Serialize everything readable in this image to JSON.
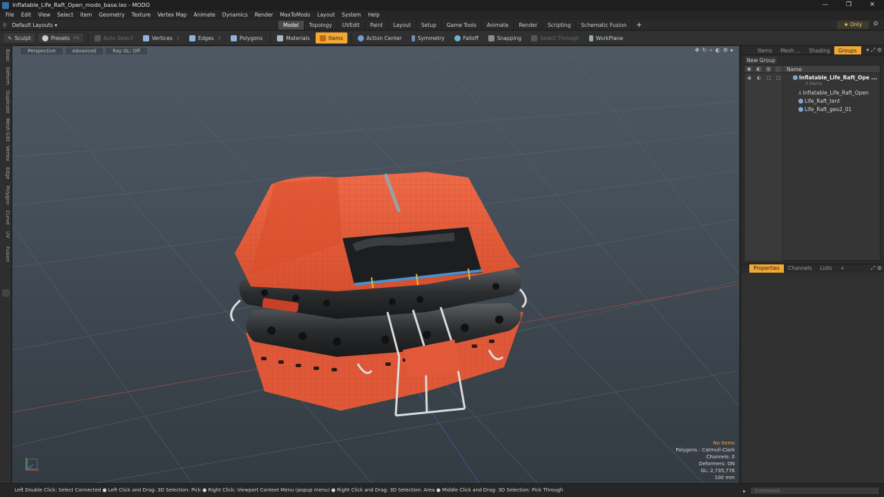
{
  "window": {
    "title": "Inflatable_Life_Raft_Open_modo_base.lxo - MODO",
    "controls": [
      "—",
      "❐",
      "✕"
    ]
  },
  "menu": [
    "File",
    "Edit",
    "View",
    "Select",
    "Item",
    "Geometry",
    "Texture",
    "Vertex Map",
    "Animate",
    "Dynamics",
    "Render",
    "MaxToModo",
    "Layout",
    "System",
    "Help"
  ],
  "layout_dropdown": "Default Layouts ▾",
  "tabs": [
    "Model",
    "Topology",
    "UVEdit",
    "Paint",
    "Layout",
    "Setup",
    "Game Tools",
    "Animate",
    "Render",
    "Scripting",
    "Schematic Fusion"
  ],
  "active_tab": "Model",
  "only_label": "★  Only",
  "toolbar": {
    "sculpt": "Sculpt",
    "presets": "Presets",
    "presets_key": "F6",
    "auto_select": "Auto Select",
    "vertices": "Vertices",
    "vertices_key": "1",
    "edges": "Edges",
    "edges_key": "2",
    "polygons": "Polygons",
    "materials": "Materials",
    "items": "Items",
    "action_center": "Action Center",
    "symmetry": "Symmetry",
    "falloff": "Falloff",
    "snapping": "Snapping",
    "select_through": "Select Through",
    "workplane": "WorkPlane"
  },
  "left_tabs": [
    "Basic",
    "Deform",
    "Duplicate",
    "Mesh Edit",
    "Vertex",
    "Edge",
    "Polygon",
    "Curve",
    "UV",
    "Fusion"
  ],
  "viewport": {
    "view_mode": "Perspective",
    "shading": "Advanced",
    "raygl": "Ray GL: Off",
    "tools": [
      "✥",
      "↻",
      "⌕",
      "◐",
      "⚙",
      "▸"
    ],
    "info": {
      "selection": "No Items",
      "polygons": "Polygons : Catmull-Clark",
      "channels": "Channels: 0",
      "deformers": "Deformers: ON",
      "gl": "GL: 2,735,776",
      "scale": "100 mm"
    }
  },
  "right_panel": {
    "tabs": [
      "Items",
      "Mesh ...",
      "Shading",
      "Groups"
    ],
    "active_tab": "Groups",
    "new_group": "New Group",
    "name_header": "Name",
    "tree": {
      "root": "Inflatable_Life_Raft_Ope ...",
      "root_count": "3 Items",
      "children": [
        "Inflatable_Life_Raft_Open",
        "Life_Raft_tent",
        "Life_Raft_geo2_01"
      ]
    },
    "props_tabs": [
      "Properties",
      "Channels",
      "Lists"
    ],
    "props_active": "Properties"
  },
  "status": {
    "hint": "Left Double Click: Select Connected ● Left Click and Drag: 3D Selection: Pick ● Right Click: Viewport Context Menu (popup menu) ● Right Click and Drag: 3D Selection: Area ● Middle Click and Drag: 3D Selection: Pick Through",
    "command_placeholder": "Command"
  },
  "colors": {
    "accent": "#f3a833",
    "raft_orange": "#e85a38",
    "tube_dark": "#2c2e30"
  }
}
